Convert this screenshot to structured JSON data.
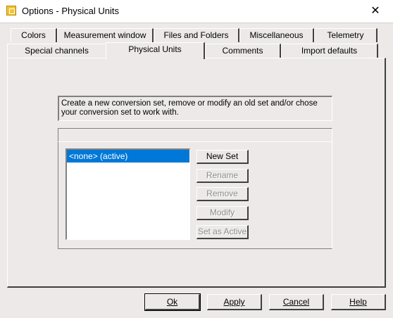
{
  "window": {
    "title": "Options - Physical Units",
    "close_symbol": "✕"
  },
  "tabs_row1": [
    "Colors",
    "Measurement window",
    "Files and Folders",
    "Miscellaneous",
    "Telemetry"
  ],
  "tabs_row2": [
    "Special channels",
    "Physical Units",
    "Comments",
    "Import defaults"
  ],
  "active_tab": "Physical Units",
  "description": "Create a new conversion set, remove or modify an old set and/or chose your conversion set to work with.",
  "conversion_sets": [
    {
      "label": "<none> (active)",
      "selected": true
    }
  ],
  "side_buttons": {
    "new_set": "New Set",
    "rename": "Rename",
    "remove": "Remove",
    "modify": "Modify",
    "set_active": "Set as Active"
  },
  "bottom_buttons": {
    "ok": "Ok",
    "apply": "Apply",
    "cancel": "Cancel",
    "help": "Help"
  }
}
